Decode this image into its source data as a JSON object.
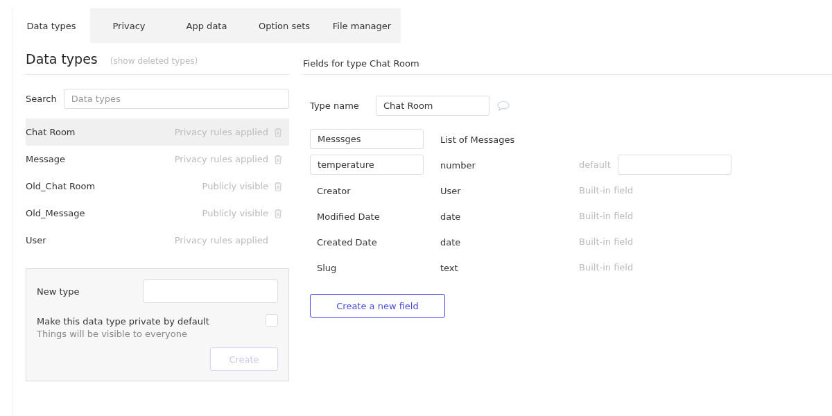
{
  "tabs": [
    {
      "label": "Data types",
      "selected": true
    },
    {
      "label": "Privacy",
      "selected": false
    },
    {
      "label": "App data",
      "selected": false
    },
    {
      "label": "Option sets",
      "selected": false
    },
    {
      "label": "File manager",
      "selected": false
    }
  ],
  "left": {
    "title": "Data types",
    "deleted_link": "(show deleted types)",
    "search_label": "Search",
    "search_placeholder": "Data types",
    "types": [
      {
        "name": "Chat Room",
        "privacy": "Privacy rules applied",
        "selected": true,
        "deletable": true
      },
      {
        "name": "Message",
        "privacy": "Privacy rules applied",
        "selected": false,
        "deletable": true
      },
      {
        "name": "Old_Chat Room",
        "privacy": "Publicly visible",
        "selected": false,
        "deletable": true
      },
      {
        "name": "Old_Message",
        "privacy": "Publicly visible",
        "selected": false,
        "deletable": true
      },
      {
        "name": "User",
        "privacy": "Privacy rules applied",
        "selected": false,
        "deletable": false
      }
    ],
    "new_type": {
      "label": "New type",
      "private_label": "Make this data type private by default",
      "private_hint": "Things will be visible to everyone",
      "checked": false,
      "button": "Create",
      "disabled": true
    }
  },
  "right": {
    "title": "Fields for type Chat Room",
    "type_name_label": "Type name",
    "type_name": "Chat Room",
    "fields": [
      {
        "kind": "custom",
        "name": "Messsges",
        "type": "List of Messages"
      },
      {
        "kind": "custom",
        "name": "temperature",
        "type": "number",
        "default_label": "default"
      },
      {
        "kind": "builtin",
        "name": "Creator",
        "type": "User",
        "note": "Built-in field"
      },
      {
        "kind": "builtin",
        "name": "Modified Date",
        "type": "date",
        "note": "Built-in field"
      },
      {
        "kind": "builtin",
        "name": "Created Date",
        "type": "date",
        "note": "Built-in field"
      },
      {
        "kind": "builtin",
        "name": "Slug",
        "type": "text",
        "note": "Built-in field"
      }
    ],
    "new_field_button": "Create a new field"
  }
}
